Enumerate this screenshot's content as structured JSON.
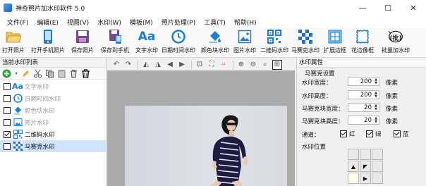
{
  "window": {
    "title": "神奇照片加水印软件 5.0",
    "minimize": "—",
    "maximize": "☐",
    "close": "✕"
  },
  "menu": [
    "文件(F)",
    "编辑(E)",
    "视图(V)",
    "水印(W)",
    "模板(M)",
    "照片处理(P)",
    "工具(T)",
    "帮助(H)"
  ],
  "toolbar": {
    "open_photo": "打开照片",
    "open_phone_photo": "打开手机照片",
    "save_photo": "保存照片",
    "save_to_phone": "保存到手机",
    "text_wm": "文字水印",
    "datetime_wm": "日期时间水印",
    "color_block_wm": "颜色块水印",
    "image_wm": "图片水印",
    "qrcode_wm": "二维码水印",
    "mosaic_wm": "马赛克水印",
    "border": "扩展边框",
    "flower_border": "花边像框",
    "batch_wm": "批量加水印",
    "aa_glyph": "Aa",
    "batch_glyph": "(批)"
  },
  "left_panel": {
    "title": "当前水印列表",
    "items": [
      {
        "label": "文字水印",
        "checked": false,
        "icon": "text-aa-icon",
        "glyph": "Aa"
      },
      {
        "label": "日期时间水印",
        "checked": false,
        "icon": "clock-icon"
      },
      {
        "label": "颜色块水印",
        "checked": false,
        "icon": "paint-bucket-icon"
      },
      {
        "label": "图片水印",
        "checked": false,
        "icon": "picture-icon"
      },
      {
        "label": "二维码水印",
        "checked": true,
        "icon": "qrcode-icon"
      },
      {
        "label": "马赛克水印",
        "checked": false,
        "icon": "mosaic-icon"
      }
    ]
  },
  "right_panel": {
    "title": "水印属性",
    "mosaic_group": "马赛克设置",
    "width_label": "水印宽度：",
    "width_value": "200",
    "height_label": "水印高度：",
    "height_value": "200",
    "block_w_label": "马赛克块宽度：",
    "block_w_value": "20",
    "block_h_label": "马赛克块高度：",
    "block_h_value": "20",
    "unit": "像素",
    "channel_label": "通道：",
    "channels": [
      {
        "label": "红",
        "checked": true
      },
      {
        "label": "绿",
        "checked": true
      },
      {
        "label": "蓝",
        "checked": true
      }
    ],
    "position_group": "水印位置"
  },
  "colors": {
    "accent_blue": "#1a7fd8",
    "selection": "#cfe3fb",
    "checker": "#1e6fd0"
  }
}
